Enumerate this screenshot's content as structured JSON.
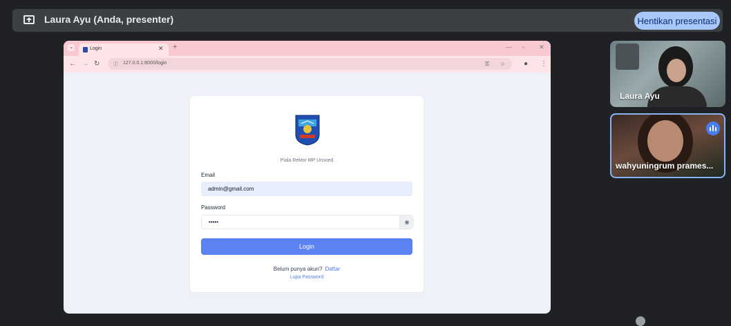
{
  "meet": {
    "presenter_title": "Laura Ayu (Anda, presenter)",
    "stop_presenting_label": "Hentikan presentasi"
  },
  "browser": {
    "tab_title": "Login",
    "url": "127.0.0.1:8000/login"
  },
  "login": {
    "org_name": "Piala Rektor MP Unsoed",
    "email_label": "Email",
    "email_value": "admin@gmail.com",
    "password_label": "Password",
    "password_value": "•••••",
    "login_button": "Login",
    "signup_prompt": "Belum punya akun?",
    "signup_link": "Daftar",
    "forgot_link": "Lupa Password"
  },
  "participants": [
    {
      "name": "Laura Ayu"
    },
    {
      "name": "wahyuningrum prames...",
      "speaking": true
    }
  ],
  "colors": {
    "accent": "#a8c7fa",
    "button": "#5b82f0",
    "tabstrip": "#f8c9d0"
  }
}
